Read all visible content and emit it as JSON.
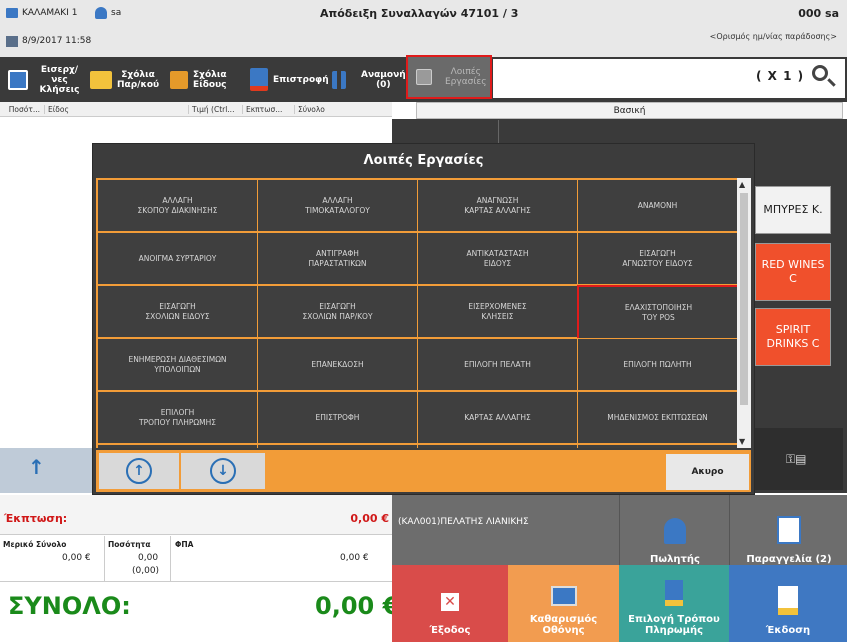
{
  "topbar": {
    "store": "ΚΑΛΑΜΑΚΙ 1",
    "user": "sa",
    "datetime": "8/9/2017 11:58",
    "title": "Απόδειξη Συναλλαγών 47101 / 3",
    "count_user": "000  sa",
    "delivery_link": "<Ορισμός ημ/νίας παράδοσης>"
  },
  "toolbar": {
    "pending_calls": "Εισερχ/νες\nΚλήσεις",
    "order_comments": "Σχόλια\nΠαρ/κού",
    "item_comments": "Σχόλια\nΕίδους",
    "return": "Επιστροφή",
    "waiting": "Αναμονή\n(0)",
    "other_tasks": "Λοιπές\nΕργασίες",
    "quantity": "( X 1 )"
  },
  "grid": {
    "headers": [
      "Ποσότ...",
      "Είδος",
      "Τιμή (Ctrl...",
      "Εκπτωσ...",
      "Σύνολο"
    ]
  },
  "category_tab": "Βασική",
  "side_buttons": [
    "ΜΠΥΡΕΣ Κ.",
    "RED WINES\nC",
    "SPIRIT\nDRINKS C"
  ],
  "dialog": {
    "title": "Λοιπές Εργασίες",
    "cells": [
      "ΑΛΛΑΓΗ\nΣΚΟΠΟΥ ΔΙΑΚΙΝΗΣΗΣ",
      "ΑΛΛΑΓΗ\nΤΙΜΟΚΑΤΑΛΟΓΟΥ",
      "ΑΝΑΓΝΩΣΗ\nΚΑΡΤΑΣ ΑΛΛΑΓΗΣ",
      "ΑΝΑΜΟΝΗ",
      "ΑΝΟΙΓΜΑ ΣΥΡΤΑΡΙΟΥ",
      "ΑΝΤΙΓΡΑΦΗ\nΠΑΡΑΣΤΑΤΙΚΩΝ",
      "ΑΝΤΙΚΑΤΑΣΤΑΣΗ\nΕΙΔΟΥΣ",
      "ΕΙΣΑΓΩΓΗ\nΑΓΝΩΣΤΟΥ ΕΙΔΟΥΣ",
      "ΕΙΣΑΓΩΓΗ\nΣΧΟΛΙΩΝ ΕΙΔΟΥΣ",
      "ΕΙΣΑΓΩΓΗ\nΣΧΟΛΙΩΝ ΠΑΡ/ΚΟΥ",
      "ΕΙΣΕΡΧΟΜΕΝΕΣ\nΚΛΗΣΕΙΣ",
      "ΕΛΑΧΙΣΤΟΠΟΙΗΣΗ\nΤΟΥ POS",
      "ΕΝΗΜΕΡΩΣΗ ΔΙΑΘΕΣΙΜΩΝ\nΥΠΟΛΟΙΠΩΝ",
      "ΕΠΑΝΕΚΔΟΣΗ",
      "ΕΠΙΛΟΓΗ ΠΕΛΑΤΗ",
      "ΕΠΙΛΟΓΗ ΠΩΛΗΤΗ",
      "ΕΠΙΛΟΓΗ\nΤΡΟΠΟΥ ΠΛΗΡΩΜΗΣ",
      "ΕΠΙΣΤΡΟΦΗ",
      "ΚΑΡΤΑΣ ΑΛΛΑΓΗΣ",
      "ΜΗΔΕΝΙΣΜΟΣ ΕΚΠΤΩΣΕΩΝ"
    ],
    "cancel": "Ακυρο"
  },
  "totals": {
    "discount_label": "Έκπτωση:",
    "discount_value": "0,00 €",
    "subtotal_label": "Μερικό Σύνολο",
    "subtotal_value": "0,00 €",
    "qty_label": "Ποσότητα",
    "qty_value": "0,00",
    "qty_value2": "(0,00)",
    "vat_label": "ΦΠΑ",
    "vat_value": "0,00 €",
    "total_label": "ΣΥΝΟΛΟ:",
    "total_value": "0,00 €"
  },
  "customer": "(ΚΑΛ001)ΠΕΛΑΤΗΣ ΛΙΑΝΙΚΗΣ",
  "bottom_buttons": {
    "salesman": "Πωλητής",
    "orders": "Παραγγελία (2)",
    "exit": "Έξοδος",
    "clear": "Καθαρισμός\nΟθόνης",
    "payment": "Επιλογή Τρόπου\nΠληρωμής",
    "issue": "Έκδοση"
  },
  "colors": {
    "accent_orange": "#f29c38",
    "highlight_red": "#e01b1b",
    "total_green": "#1a8a1a",
    "discount_red": "#d01818"
  }
}
